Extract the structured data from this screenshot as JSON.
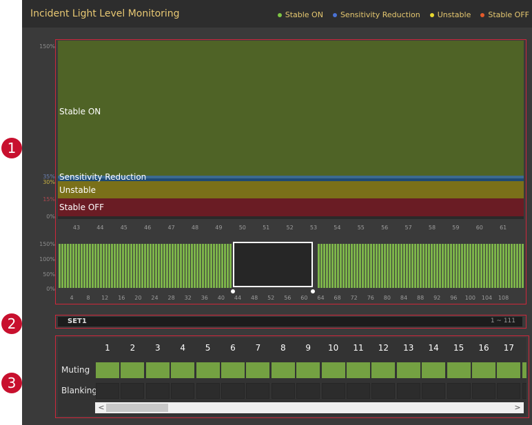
{
  "header": {
    "title": "Incident Light Level Monitoring",
    "legend": [
      {
        "label": "Stable ON",
        "color": "#7ec544"
      },
      {
        "label": "Sensitivity Reduction",
        "color": "#4a73d6"
      },
      {
        "label": "Unstable",
        "color": "#e8d82e"
      },
      {
        "label": "Stable OFF",
        "color": "#e45a2a"
      }
    ]
  },
  "top_chart": {
    "y_labels": [
      "150%",
      "35%",
      "30%",
      "15%",
      "0%"
    ],
    "bands": {
      "stable_on": "Stable ON",
      "sensitivity": "Sensitivity Reduction",
      "unstable": "Unstable",
      "stable_off": "Stable OFF"
    },
    "x_ticks": [
      "43",
      "44",
      "45",
      "46",
      "47",
      "48",
      "49",
      "50",
      "51",
      "52",
      "53",
      "54",
      "55",
      "56",
      "57",
      "58",
      "59",
      "60",
      "61"
    ]
  },
  "overview": {
    "y_labels": [
      "150%",
      "100%",
      "50%",
      "0%"
    ],
    "x_ticks": [
      "4",
      "8",
      "12",
      "16",
      "20",
      "24",
      "28",
      "32",
      "36",
      "40",
      "44",
      "48",
      "52",
      "56",
      "60",
      "64",
      "68",
      "72",
      "76",
      "80",
      "84",
      "88",
      "92",
      "96",
      "100",
      "104",
      "108"
    ]
  },
  "set_bar": {
    "name": "SET1",
    "range": "1 ~ 111"
  },
  "grid": {
    "columns": [
      "1",
      "2",
      "3",
      "4",
      "5",
      "6",
      "7",
      "8",
      "9",
      "10",
      "11",
      "12",
      "13",
      "14",
      "15",
      "16",
      "17"
    ],
    "muting_label": "Muting",
    "blanking_label": "Blanking",
    "scroll_left": "<",
    "scroll_right": ">"
  },
  "annotations": [
    "1",
    "2",
    "3"
  ]
}
